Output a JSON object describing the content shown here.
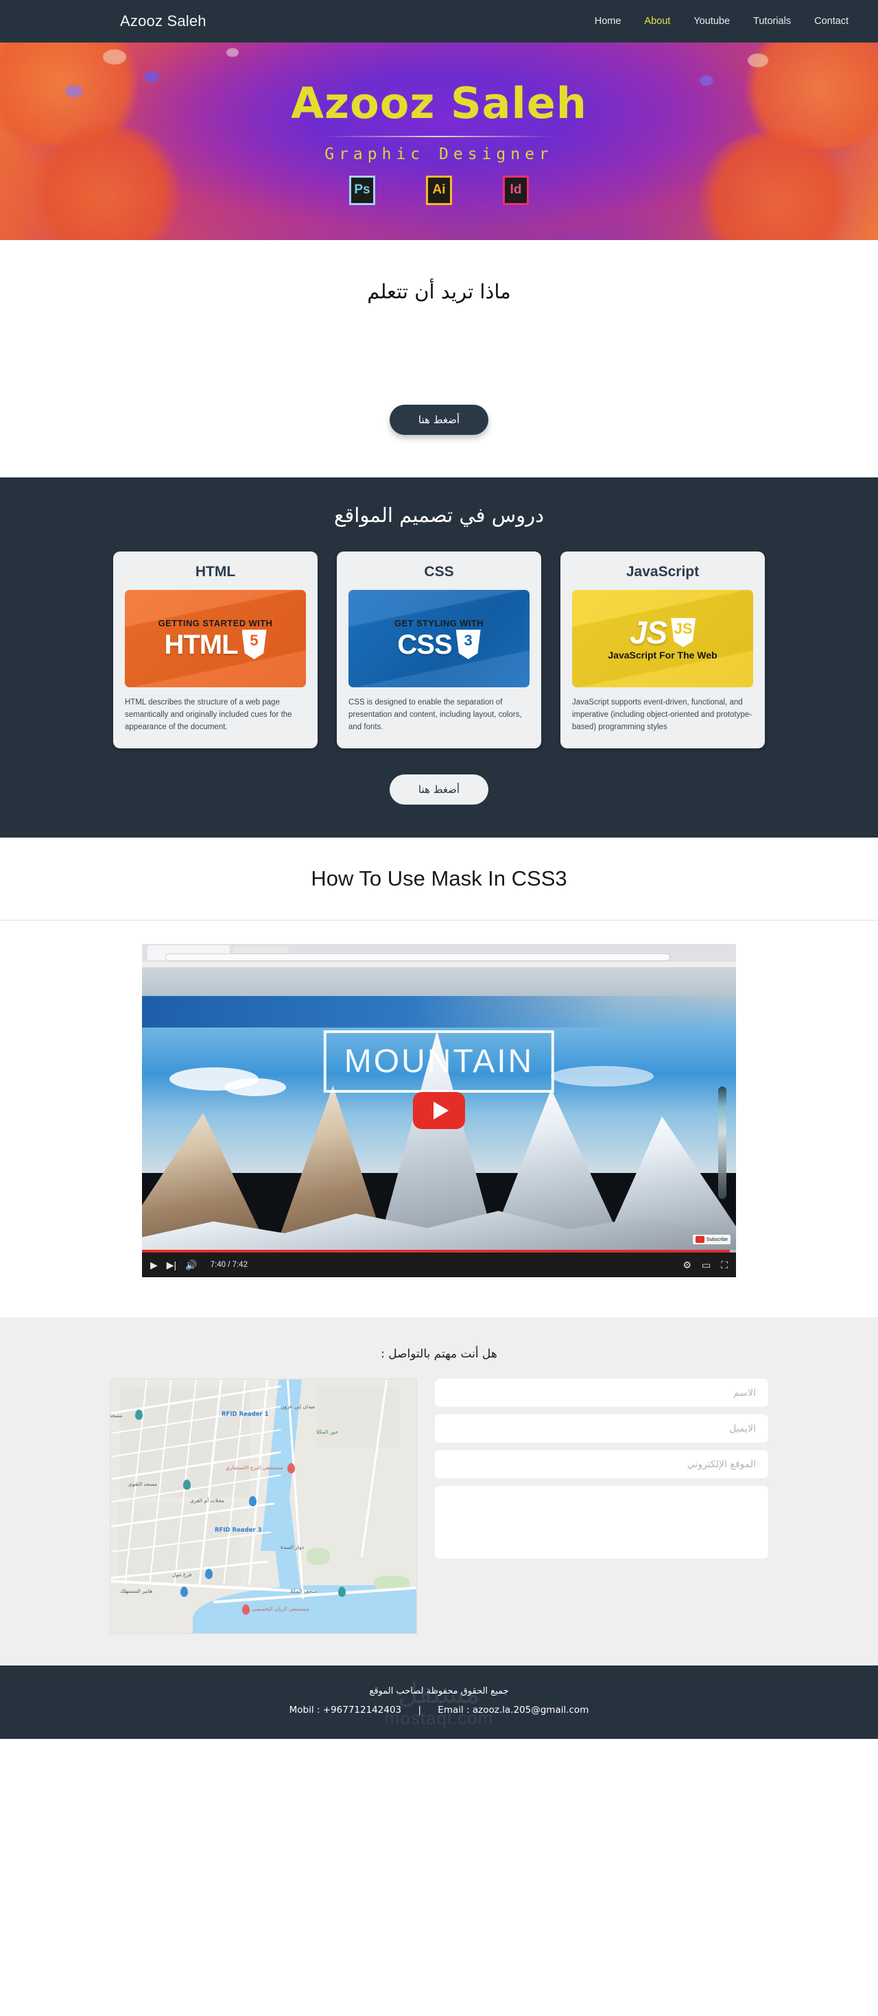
{
  "navbar": {
    "brand": "Azooz Saleh",
    "links": [
      {
        "label": "Home",
        "active": false
      },
      {
        "label": "About",
        "active": true
      },
      {
        "label": "Youtube",
        "active": false
      },
      {
        "label": "Tutorials",
        "active": false
      },
      {
        "label": "Contact",
        "active": false
      }
    ],
    "bg_color": "#27323f",
    "active_color": "#e8e33c"
  },
  "hero": {
    "title": "Azooz Saleh",
    "subtitle": "Graphic Designer",
    "title_color": "#e3dd2f",
    "badges": [
      {
        "label": "Ps",
        "border_color": "#9fd4ee",
        "text_color": "#67d0f4"
      },
      {
        "label": "Ai",
        "border_color": "#fcb81e",
        "text_color": "#fcb81e"
      },
      {
        "label": "Id",
        "border_color": "#ef2f73",
        "text_color": "#ef4d8a"
      }
    ]
  },
  "learn": {
    "title": "ماذا تريد أن تتعلم",
    "button_label": "أضغط هنا"
  },
  "lessons": {
    "title": "دروس في تصميم المواقع",
    "button_label": "أضغط هنا",
    "cards": [
      {
        "title": "HTML",
        "banner_kicker": "GETTING STARTED WITH",
        "banner_word": "HTML",
        "banner_shield": "5",
        "banner_color": "#e8601f",
        "desc": "HTML describes the structure of a web page semantically and originally included cues for the appearance of the document."
      },
      {
        "title": "CSS",
        "banner_kicker": "GET STYLING WITH",
        "banner_word": "CSS",
        "banner_shield": "3",
        "banner_color": "#1362ad",
        "desc": "CSS is designed to enable the separation of presentation and content, including layout, colors, and fonts."
      },
      {
        "title": "JavaScript",
        "banner_kicker": "",
        "banner_word": "JS",
        "banner_shield": "JS",
        "banner_caption": "JavaScript For The Web",
        "banner_color": "#edc81f",
        "desc": "JavaScript supports event-driven, functional, and imperative (including object-oriented and prototype-based) programming styles"
      }
    ]
  },
  "video": {
    "title": "How To Use Mask In CSS3",
    "overlay_text": "MOUNTAIN",
    "subscribe_label": "Subscribe",
    "current_time": "7:40",
    "duration": "7:42",
    "time_display": "7:40 / 7:42",
    "progress_percent": 99,
    "controls": {
      "play": "▶",
      "next": "▶|",
      "volume": "🔊",
      "settings": "⚙",
      "theater": "▭",
      "fullscreen": "⛶"
    }
  },
  "contact": {
    "title": "هل أنت مهتم بالتواصل :",
    "fields": [
      {
        "name": "name",
        "placeholder": "الاسم",
        "value": ""
      },
      {
        "name": "email",
        "placeholder": "الايميل",
        "value": ""
      },
      {
        "name": "website",
        "placeholder": "الموقع الإلكتروني",
        "value": ""
      },
      {
        "name": "message",
        "placeholder": "",
        "value": ""
      }
    ],
    "map": {
      "labels": [
        {
          "text": "RFID Reader 1",
          "type": "blue"
        },
        {
          "text": "RFID Reader 3",
          "type": "blue"
        },
        {
          "text": "ميدان إبن عزون",
          "type": "plain"
        },
        {
          "text": "خور المكلا",
          "type": "green"
        },
        {
          "text": "مسجد",
          "type": "plain"
        },
        {
          "text": "مسجد التقوى",
          "type": "plain"
        },
        {
          "text": "مستشفى البرج الاستشاري",
          "type": "red"
        },
        {
          "text": "محلات أم القرى",
          "type": "plain"
        },
        {
          "text": "دوار السدة",
          "type": "plain"
        },
        {
          "text": "فرح مول",
          "type": "plain"
        },
        {
          "text": "هايبر المستهلك",
          "type": "plain"
        },
        {
          "text": "متحف المكلا",
          "type": "plain"
        },
        {
          "text": "مستشفى الريان التخصصي",
          "type": "red"
        }
      ]
    }
  },
  "footer": {
    "copyright": "جميع الحقوق محفوظة لصاحب الموقع",
    "mobile_label": "Mobil :",
    "mobile_value": "+967712142403",
    "separator": "|",
    "email_label": "Email :",
    "email_value": "azooz.la.205@gmail.com",
    "watermark_ar": "مستقل",
    "watermark_en": "mostaql.com"
  }
}
